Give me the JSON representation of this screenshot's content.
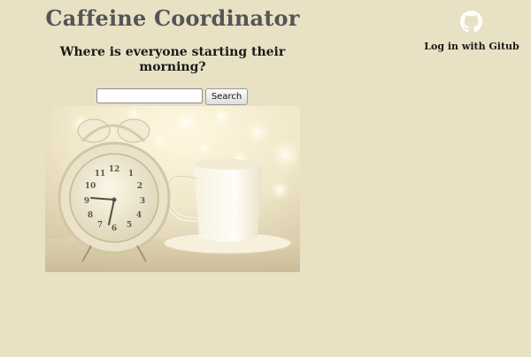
{
  "header": {
    "title": "Caffeine Coordinator",
    "subtitle": "Where is everyone starting their morning?"
  },
  "search": {
    "value": "",
    "placeholder": "",
    "button_label": "Search"
  },
  "hero_image": {
    "icon": "alarm-clock-and-coffee-cup-photo",
    "clock_numbers": [
      "12",
      "1",
      "2",
      "3",
      "4",
      "5",
      "6",
      "7",
      "8",
      "9",
      "10",
      "11"
    ]
  },
  "auth": {
    "icon": "github-icon",
    "login_label": "Log in with Gitub"
  },
  "colors": {
    "background": "#e8e1c4",
    "title": "#555555",
    "text": "#1a1a1a"
  }
}
